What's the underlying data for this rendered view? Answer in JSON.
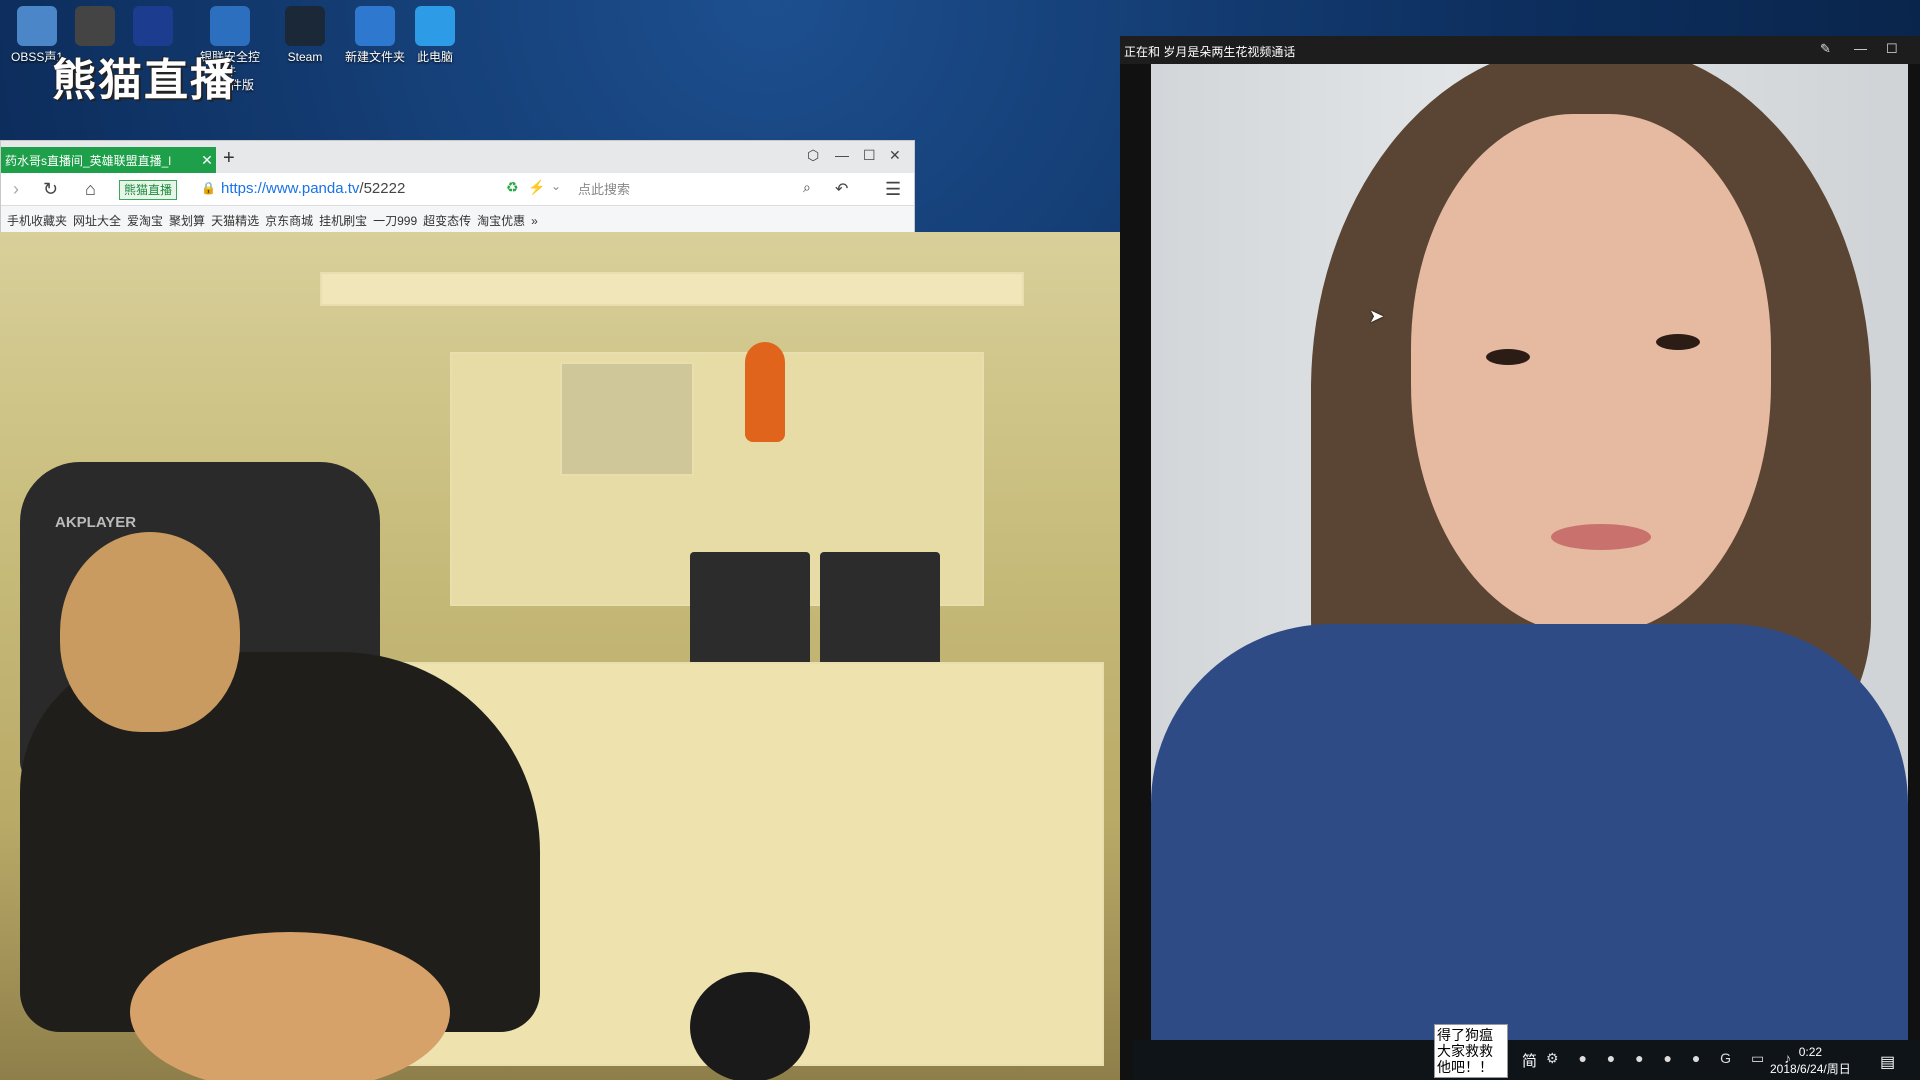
{
  "desktop": {
    "watermark": "熊猫直播",
    "icons": [
      {
        "label": "OBSS声1",
        "icon": "obs-icon",
        "color": "#4b86c8"
      },
      {
        "label": "",
        "icon": "monitor-app-icon",
        "color": "#444"
      },
      {
        "label": "",
        "icon": "kx-icon",
        "color": "#1c3d8f"
      },
      {
        "label": "银联安全控件\n非插件版",
        "icon": "shield-icon",
        "color": "#2c6fbe"
      },
      {
        "label": "Steam",
        "icon": "steam-icon",
        "color": "#1b2838"
      },
      {
        "label": "新建文件夹",
        "icon": "folder-icon",
        "color": "#2f78d0"
      },
      {
        "label": "此电脑",
        "icon": "computer-icon",
        "color": "#2e9be6"
      }
    ]
  },
  "browser": {
    "tab_label": "药水哥s直播间_英雄联盟直播_l",
    "tab_close": "✕",
    "new_tab": "+",
    "site_badge": "熊猫直播",
    "url_host": "https://www.panda.tv",
    "url_path": "/52222",
    "search_placeholder": "点此搜索",
    "bookmarks": [
      "手机收藏夹",
      "网址大全",
      "爱淘宝",
      "聚划算",
      "天猫精选",
      "京东商城",
      "挂机刷宝",
      "一刀999",
      "超变态传",
      "淘宝优惠",
      "»"
    ],
    "controls": {
      "minimize": "—",
      "maximize": "☐",
      "close": "✕"
    }
  },
  "stream": {
    "chair_brand": "AKPLAYER"
  },
  "call": {
    "title": "正在和   岁月是朵两生花视频通话",
    "controls": {
      "pin": "✎",
      "minimize": "—",
      "maximize": "☐"
    }
  },
  "taskbar": {
    "overlay_note": "得了狗瘟\n大家救救\n他吧！！",
    "ime": "简",
    "tray": "⚙ ● ● ● ● ● G ▭ ♪",
    "time": "0:22",
    "date": "2018/6/24/周日",
    "notification": "▤"
  }
}
